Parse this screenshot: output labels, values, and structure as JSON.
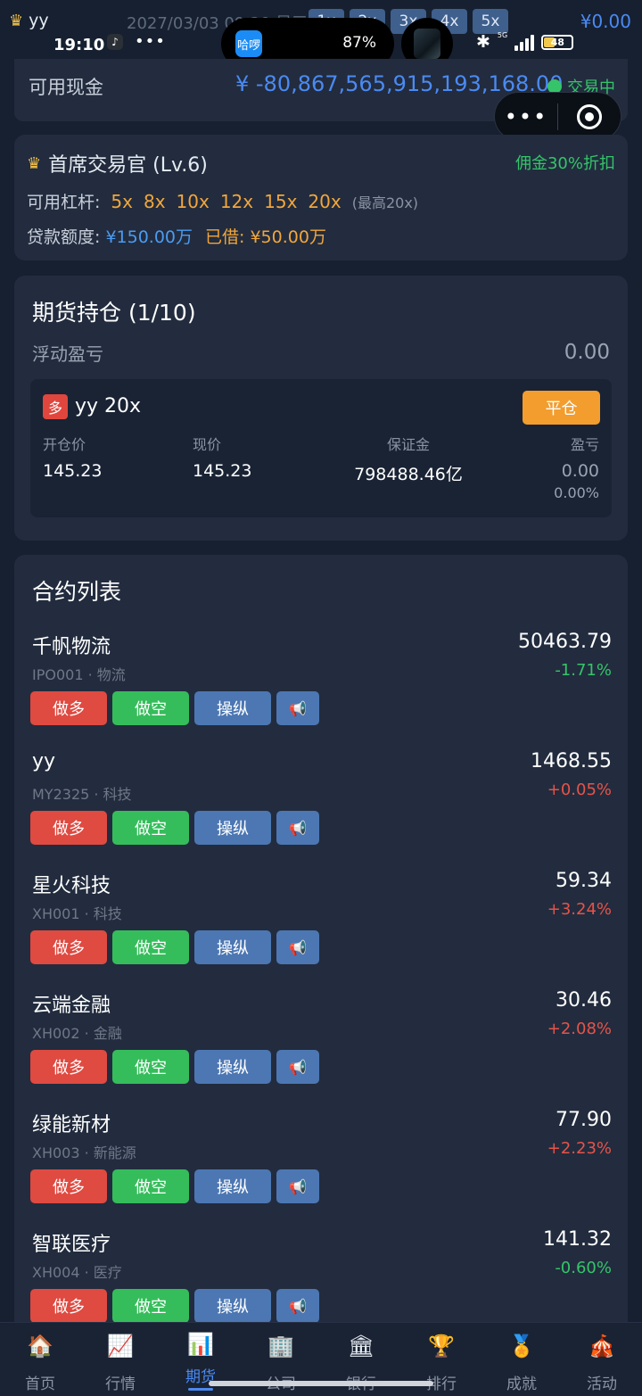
{
  "top": {
    "user_name": "yy",
    "date_time": "2027/03/03 09:20 星三",
    "speed_buttons": [
      "1x",
      "2x",
      "3x",
      "4x",
      "5x"
    ],
    "money": "¥0.00"
  },
  "status_bar": {
    "time": "19:10",
    "app_badge": "哈啰",
    "battery_percent": "87%",
    "network": "5G",
    "battery_level": "48"
  },
  "cash": {
    "label": "可用现金",
    "value": "¥ -80,867,565,915,193,168.00",
    "status": "交易中"
  },
  "vip": {
    "title": "首席交易官 (Lv.6)",
    "discount": "佣金30%折扣",
    "leverage_label": "可用杠杆:",
    "leverages": [
      "5x",
      "8x",
      "10x",
      "12x",
      "15x",
      "20x"
    ],
    "leverage_max": "(最高20x)",
    "loan_label": "贷款额度:",
    "loan_amount": "¥150.00万",
    "borrowed": "已借: ¥50.00万"
  },
  "positions": {
    "title": "期货持仓 (1/10)",
    "pnl_label": "浮动盈亏",
    "pnl_value": "0.00",
    "items": [
      {
        "tag": "多",
        "name": "yy 20x",
        "close_label": "平仓",
        "open_label": "开仓价",
        "open_value": "145.23",
        "cur_label": "现价",
        "cur_value": "145.23",
        "margin_label": "保证金",
        "margin_value": "798488.46亿",
        "pnl_label": "盈亏",
        "pnl_value": "0.00",
        "pnl_pct": "0.00%"
      }
    ]
  },
  "contracts": {
    "title": "合约列表",
    "buttons": {
      "long": "做多",
      "short": "做空",
      "manip": "操纵"
    },
    "items": [
      {
        "name": "千帆物流",
        "code": "IPO001 · 物流",
        "price": "50463.79",
        "change": "-1.71%"
      },
      {
        "name": "yy",
        "code": "MY2325 · 科技",
        "price": "1468.55",
        "change": "+0.05%"
      },
      {
        "name": "星火科技",
        "code": "XH001 · 科技",
        "price": "59.34",
        "change": "+3.24%"
      },
      {
        "name": "云端金融",
        "code": "XH002 · 金融",
        "price": "30.46",
        "change": "+2.08%"
      },
      {
        "name": "绿能新材",
        "code": "XH003 · 新能源",
        "price": "77.90",
        "change": "+2.23%"
      },
      {
        "name": "智联医疗",
        "code": "XH004 · 医疗",
        "price": "141.32",
        "change": "-0.60%"
      }
    ]
  },
  "nav": {
    "items": [
      {
        "label": "首页",
        "icon": "home-icon"
      },
      {
        "label": "行情",
        "icon": "chart-icon"
      },
      {
        "label": "期货",
        "icon": "futures-icon"
      },
      {
        "label": "公司",
        "icon": "company-icon"
      },
      {
        "label": "银行",
        "icon": "bank-icon"
      },
      {
        "label": "排行",
        "icon": "trophy-icon"
      },
      {
        "label": "成就",
        "icon": "medal-icon"
      },
      {
        "label": "活动",
        "icon": "tent-icon"
      }
    ],
    "active": "期货"
  },
  "colors": {
    "accent": "#4b8af2",
    "up": "#e65349",
    "down": "#35c46a",
    "warning": "#f29d2e"
  }
}
